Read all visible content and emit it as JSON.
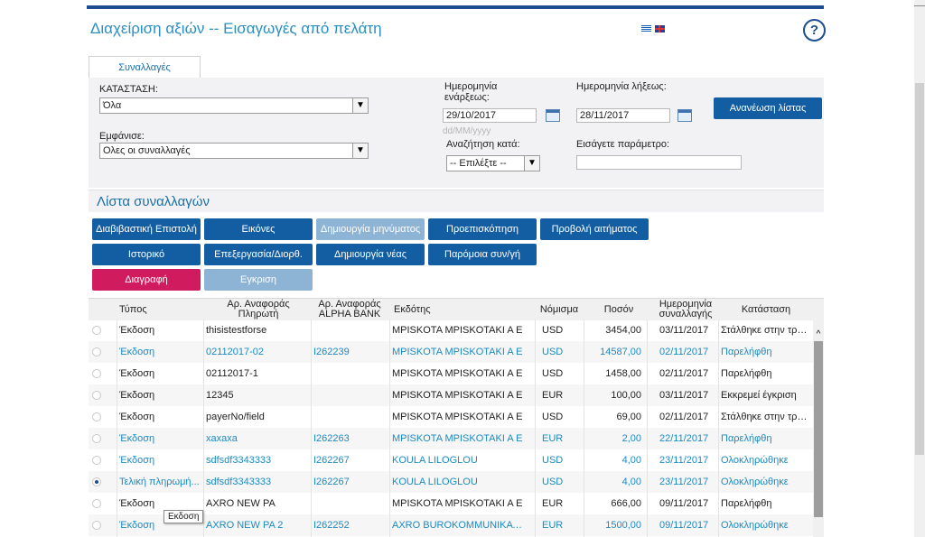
{
  "header": {
    "title": "Διαχείριση αξιών -- Εισαγωγές από πελάτη",
    "help_label": "?",
    "languages": [
      "greek-flag",
      "uk-flag"
    ]
  },
  "tabs": [
    {
      "label": "Συναλλαγές"
    }
  ],
  "filters": {
    "status_label": "ΚΑΤΑΣΤΑΣΗ:",
    "status_value": "Όλα",
    "show_label": "Εμφάνισε:",
    "show_value": "Ολες οι συναλλαγές",
    "start_date_label": "Ημερομηνία ενάρξεως:",
    "start_date_value": "29/10/2017",
    "start_date_hint": "dd/MM/yyyy",
    "end_date_label": "Ημερομηνία λήξεως:",
    "end_date_value": "28/11/2017",
    "search_by_label": "Αναζήτηση κατά:",
    "search_by_value": "-- Επιλέξτε --",
    "param_label": "Εισάγετε παράμετρο:",
    "param_value": "",
    "refresh_label": "Ανανέωση λίστας"
  },
  "list": {
    "title": "Λίστα συναλλαγών",
    "buttons": {
      "letter": "Διαβιβαστική Επιστολή",
      "images": "Εικόνες",
      "create_message": "Δημιουργία μηνύματος",
      "preview": "Προεπισκόπηση",
      "view_request": "Προβολή αιτήματος",
      "history": "Ιστορικό",
      "edit": "Επεξεργασία/Διορθ.",
      "create_new": "Δημιουργία νέας",
      "similar": "Παρόμοια συν/γή",
      "delete": "Διαγραφή",
      "approve": "Εγκριση"
    }
  },
  "table": {
    "columns": {
      "type": "Τύπος",
      "payer_ref": "Αρ. Αναφοράς Πληρωτή",
      "alpha_ref": "Αρ. Αναφοράς ALPHA BANK",
      "issuer": "Εκδότης",
      "currency": "Νόμισμα",
      "amount": "Ποσόν",
      "date": "Ημερομηνία συναλλαγής",
      "status": "Κατάσταση"
    },
    "rows": [
      {
        "selected": false,
        "blue": false,
        "type": "Έκδοση",
        "payer_ref": "thisistestforse",
        "alpha_ref": "",
        "issuer": "MPISKOTA MPISKOTAKI A E",
        "currency": "USD",
        "amount": "3454,00",
        "date": "03/11/2017",
        "status": "Στάλθηκε στην τρά..."
      },
      {
        "selected": false,
        "blue": true,
        "type": "Έκδοση",
        "payer_ref": "02112017-02",
        "alpha_ref": "I262239",
        "issuer": "MPISKOTA MPISKOTAKI A E",
        "currency": "USD",
        "amount": "14587,00",
        "date": "02/11/2017",
        "status": "Παρελήφθη"
      },
      {
        "selected": false,
        "blue": false,
        "type": "Έκδοση",
        "payer_ref": "02112017-1",
        "alpha_ref": "",
        "issuer": "MPISKOTA MPISKOTAKI A E",
        "currency": "USD",
        "amount": "1458,00",
        "date": "02/11/2017",
        "status": "Παρελήφθη"
      },
      {
        "selected": false,
        "blue": false,
        "type": "Έκδοση",
        "payer_ref": "12345",
        "alpha_ref": "",
        "issuer": "MPISKOTA MPISKOTAKI A E",
        "currency": "EUR",
        "amount": "100,00",
        "date": "03/11/2017",
        "status": "Εκκρεμεί έγκριση"
      },
      {
        "selected": false,
        "blue": false,
        "type": "Έκδοση",
        "payer_ref": "payerNo/field",
        "alpha_ref": "",
        "issuer": "MPISKOTA MPISKOTAKI A E",
        "currency": "USD",
        "amount": "69,00",
        "date": "02/11/2017",
        "status": "Στάλθηκε στην τρά..."
      },
      {
        "selected": false,
        "blue": true,
        "type": "Έκδοση",
        "payer_ref": "xaxaxa",
        "alpha_ref": "I262263",
        "issuer": "MPISKOTA MPISKOTAKI A E",
        "currency": "EUR",
        "amount": "2,00",
        "date": "22/11/2017",
        "status": "Παρελήφθη"
      },
      {
        "selected": false,
        "blue": true,
        "type": "Έκδοση",
        "payer_ref": "sdfsdf3343333",
        "alpha_ref": "I262267",
        "issuer": "KOULA LILOGLOU",
        "currency": "USD",
        "amount": "4,00",
        "date": "23/11/2017",
        "status": "Ολοκληρώθηκε"
      },
      {
        "selected": true,
        "blue": true,
        "type": "Τελική πληρωμή...",
        "payer_ref": "sdfsdf3343333",
        "alpha_ref": "I262267",
        "issuer": "KOULA LILOGLOU",
        "currency": "USD",
        "amount": "4,00",
        "date": "23/11/2017",
        "status": "Ολοκληρώθηκε"
      },
      {
        "selected": false,
        "blue": false,
        "type": "Έκδοση",
        "payer_ref": "AXRO NEW PA",
        "alpha_ref": "",
        "issuer": "MPISKOTA MPISKOTAKI A E",
        "currency": "EUR",
        "amount": "666,00",
        "date": "09/11/2017",
        "status": "Παρελήφθη"
      },
      {
        "selected": false,
        "blue": true,
        "type": "Έκδοση",
        "payer_ref": "AXRO NEW PA 2",
        "alpha_ref": "I262252",
        "issuer": "AXRO BUROKOMMUNIKATIO...",
        "currency": "EUR",
        "amount": "1500,00",
        "date": "09/11/2017",
        "status": "Ολοκληρώθηκε"
      }
    ],
    "tooltip": "Εκδοση"
  },
  "colors": {
    "accent": "#135ea3",
    "link": "#1b8ac4",
    "danger": "#d01b5e",
    "disabled": "#8db3d5"
  }
}
